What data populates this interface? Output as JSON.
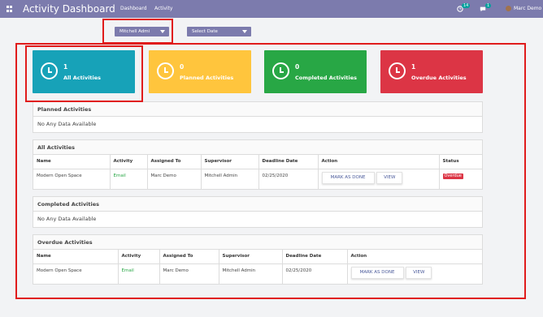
{
  "navbar": {
    "title": "Activity Dashboard",
    "menu": [
      "Dashboard",
      "Activity"
    ],
    "activity_count": "14",
    "message_count": "1",
    "user": "Marc Demo"
  },
  "filters": {
    "user_selected": "Mitchell Admi",
    "date_placeholder": "Select Date"
  },
  "cards": [
    {
      "count": "1",
      "label": "All Activities",
      "color": "#17a2b8"
    },
    {
      "count": "0",
      "label": "Planned Activities",
      "color": "#ffc53d"
    },
    {
      "count": "0",
      "label": "Completed Activities",
      "color": "#28a745"
    },
    {
      "count": "1",
      "label": "Overdue Activities",
      "color": "#dc3545"
    }
  ],
  "planned": {
    "title": "Planned Activities",
    "empty": "No Any Data Available"
  },
  "all": {
    "title": "All Activities",
    "columns": [
      "Name",
      "Activity",
      "Assigned To",
      "Supervisor",
      "Deadline Date",
      "Action",
      "Status"
    ],
    "row": {
      "name": "Modern Open Space",
      "activity": "Email",
      "assigned": "Marc Demo",
      "supervisor": "Mitchell Admin",
      "deadline": "02/25/2020",
      "status": "Overdue"
    }
  },
  "completed": {
    "title": "Completed Activities",
    "empty": "No Any Data Available"
  },
  "overdue": {
    "title": "Overdue Activities",
    "columns": [
      "Name",
      "Activity",
      "Assigned To",
      "Supervisor",
      "Deadline Date",
      "Action"
    ],
    "row": {
      "name": "Modern Open Space",
      "activity": "Email",
      "assigned": "Marc Demo",
      "supervisor": "Mitchell Admin",
      "deadline": "02/25/2020"
    }
  },
  "actions": {
    "mark_done": "MARK AS DONE",
    "view": "VIEW"
  }
}
